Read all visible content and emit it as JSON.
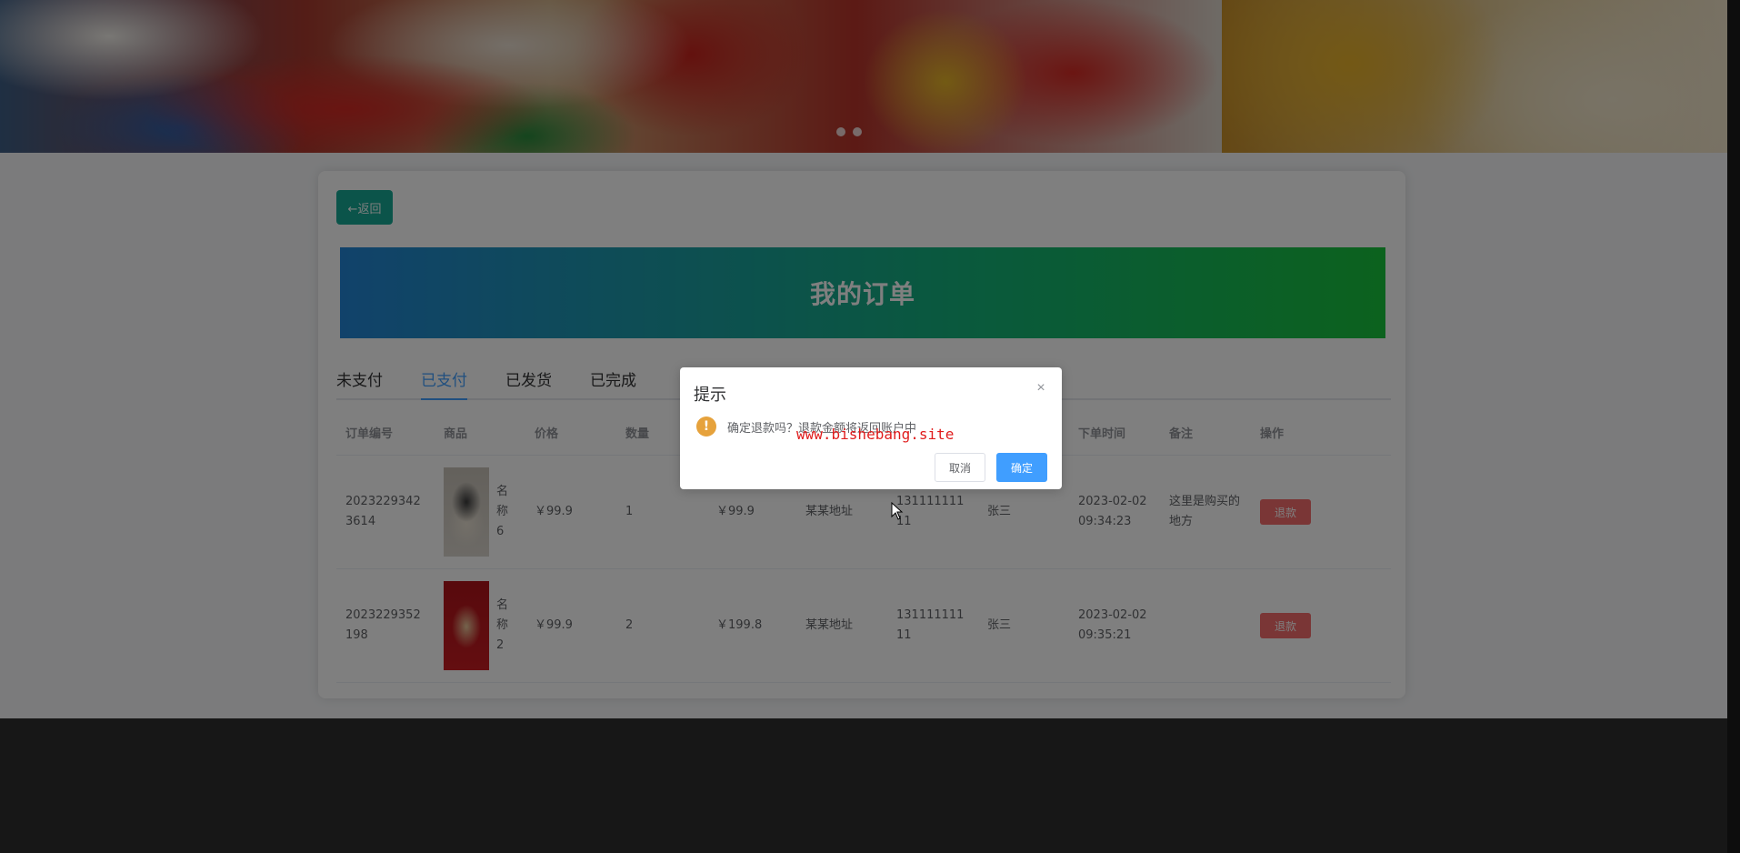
{
  "back_button": {
    "label": "←返回"
  },
  "page_title": "我的订单",
  "tabs": [
    {
      "label": "未支付",
      "active": false
    },
    {
      "label": "已支付",
      "active": true
    },
    {
      "label": "已发货",
      "active": false
    },
    {
      "label": "已完成",
      "active": false
    }
  ],
  "table": {
    "headers": {
      "id": "订单编号",
      "product": "商品",
      "price": "价格",
      "qty": "数量",
      "time": "下单时间",
      "note": "备注",
      "op": "操作"
    },
    "rows": [
      {
        "id": "20232293423614",
        "product_name": "名称6",
        "price": "￥99.9",
        "qty": "1",
        "total": "￥99.9",
        "address": "某某地址",
        "phone": "13111111111",
        "name": "张三",
        "time": "2023-02-02 09:34:23",
        "note": "这里是购买的地方",
        "action": "退款"
      },
      {
        "id": "2023229352198",
        "product_name": "名称2",
        "price": "￥99.9",
        "qty": "2",
        "total": "￥199.8",
        "address": "某某地址",
        "phone": "13111111111",
        "name": "张三",
        "time": "2023-02-02 09:35:21",
        "note": "",
        "action": "退款"
      }
    ]
  },
  "dialog": {
    "title": "提示",
    "message": "确定退款吗？退款金额将返回账户中",
    "cancel_label": "取消",
    "confirm_label": "确定",
    "close_glyph": "×",
    "icon_glyph": "!"
  },
  "watermark": "www.bishebang.site",
  "colors": {
    "accent": "#409eff",
    "danger": "#f56c6c",
    "warning": "#e6a23c",
    "back_button": "#17a994"
  }
}
